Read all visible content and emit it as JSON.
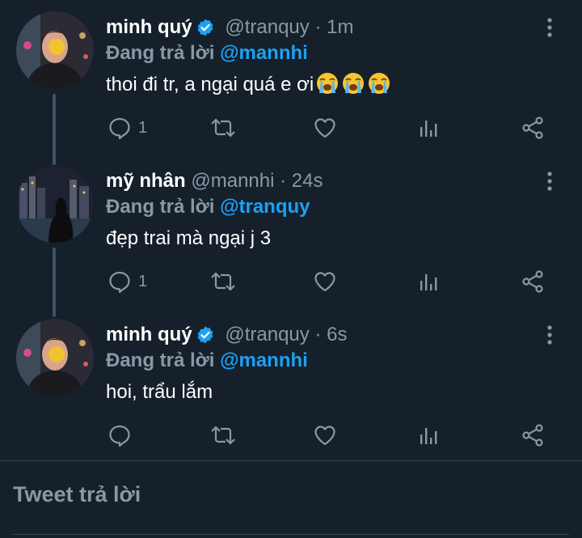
{
  "tweets": [
    {
      "name": "minh quý",
      "verified": true,
      "handle": "@tranquy",
      "separator": "·",
      "time": "1m",
      "replying_label": "Đang trả lời",
      "replying_to": "@mannhi",
      "text": "thoi đi tr, a ngại quá e ơi",
      "emoji": [
        "loudly-crying-face",
        "loudly-crying-face",
        "loudly-crying-face"
      ],
      "reply_count": "1"
    },
    {
      "name": "mỹ nhân",
      "verified": false,
      "handle": "@mannhi",
      "separator": "·",
      "time": "24s",
      "replying_label": "Đang trả lời",
      "replying_to": "@tranquy",
      "text": "đẹp trai mà ngại j 3",
      "reply_count": "1"
    },
    {
      "name": "minh quý",
      "verified": true,
      "handle": "@tranquy",
      "separator": "·",
      "time": "6s",
      "replying_label": "Đang trả lời",
      "replying_to": "@mannhi",
      "text": "hoi, trẩu lắm",
      "reply_count": ""
    }
  ],
  "compose": {
    "placeholder": "Tweet trả lời"
  },
  "colors": {
    "background": "#15202b",
    "secondary_text": "#8899a6",
    "accent": "#1da1f2",
    "divider": "#38444d"
  }
}
